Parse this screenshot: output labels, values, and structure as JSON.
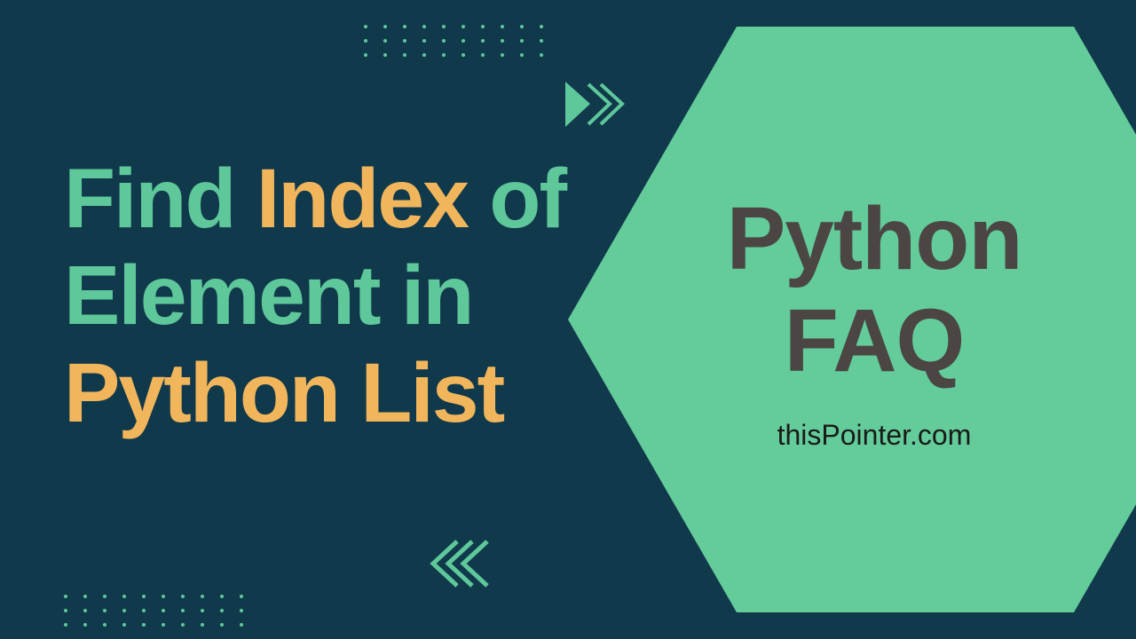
{
  "headline": {
    "w1": "Find",
    "w2": "Index",
    "w3": "of",
    "w4": "Element",
    "w5": "in",
    "w6": "Python",
    "w7": "List"
  },
  "hexagon": {
    "title_line1": "Python",
    "title_line2": "FAQ",
    "site": "thisPointer.com"
  },
  "colors": {
    "bg": "#11394c",
    "green": "#5ec89a",
    "orange": "#f1b65b",
    "hex": "#63cc9a",
    "hex_text": "#4b4644"
  }
}
